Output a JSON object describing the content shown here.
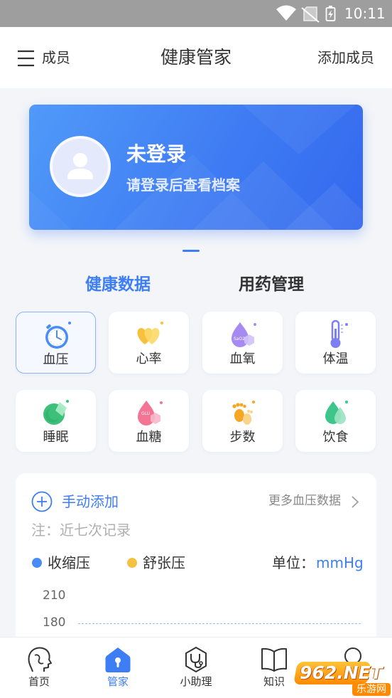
{
  "status_bar": {
    "time": "10:11",
    "icons": [
      "wifi-icon",
      "no-sim-icon",
      "battery-charging-icon"
    ]
  },
  "header": {
    "menu_icon": "menu-icon",
    "members_label": "成员",
    "title": "健康管家",
    "add_member_label": "添加成员"
  },
  "profile_card": {
    "avatar_icon": "user-avatar-icon",
    "status": "未登录",
    "hint": "请登录后查看档案"
  },
  "tabs": [
    {
      "label": "健康数据",
      "active": true
    },
    {
      "label": "用药管理",
      "active": false
    }
  ],
  "metrics": [
    {
      "label": "血压",
      "icon": "blood-pressure-icon",
      "selected": true
    },
    {
      "label": "心率",
      "icon": "heart-rate-icon",
      "selected": false
    },
    {
      "label": "血氧",
      "icon": "blood-oxygen-icon",
      "icon_text": "SaO2",
      "selected": false
    },
    {
      "label": "体温",
      "icon": "thermometer-icon",
      "selected": false
    },
    {
      "label": "睡眠",
      "icon": "sleep-icon",
      "selected": false
    },
    {
      "label": "血糖",
      "icon": "blood-glucose-icon",
      "icon_text": "GLU",
      "selected": false
    },
    {
      "label": "步数",
      "icon": "footsteps-icon",
      "selected": false
    },
    {
      "label": "饮食",
      "icon": "diet-icon",
      "selected": false
    }
  ],
  "records": {
    "add_label": "手动添加",
    "more_label": "更多血压数据",
    "note": "注：近七次记录",
    "legend": [
      {
        "label": "收缩压",
        "color": "#4a8cf7"
      },
      {
        "label": "舒张压",
        "color": "#f5c142"
      }
    ],
    "unit_label": "单位：",
    "unit_value": "mmHg",
    "y_ticks": [
      "210",
      "180"
    ]
  },
  "bottom_nav": [
    {
      "label": "首页",
      "icon": "home-head-icon",
      "active": false
    },
    {
      "label": "管家",
      "icon": "house-icon",
      "active": true
    },
    {
      "label": "小助理",
      "icon": "assistant-stethoscope-icon",
      "active": false
    },
    {
      "label": "知识",
      "icon": "book-icon",
      "active": false
    },
    {
      "icon": "profile-icon",
      "active": false
    }
  ],
  "watermark": {
    "brand": "962.NET",
    "name": "乐游网"
  },
  "colors": {
    "accent": "#3d7ef5",
    "card_gradient_start": "#509af9",
    "card_gradient_end": "#3368ee",
    "page_bg": "#f3f5f9",
    "status_bar": "#9e9e9e"
  }
}
